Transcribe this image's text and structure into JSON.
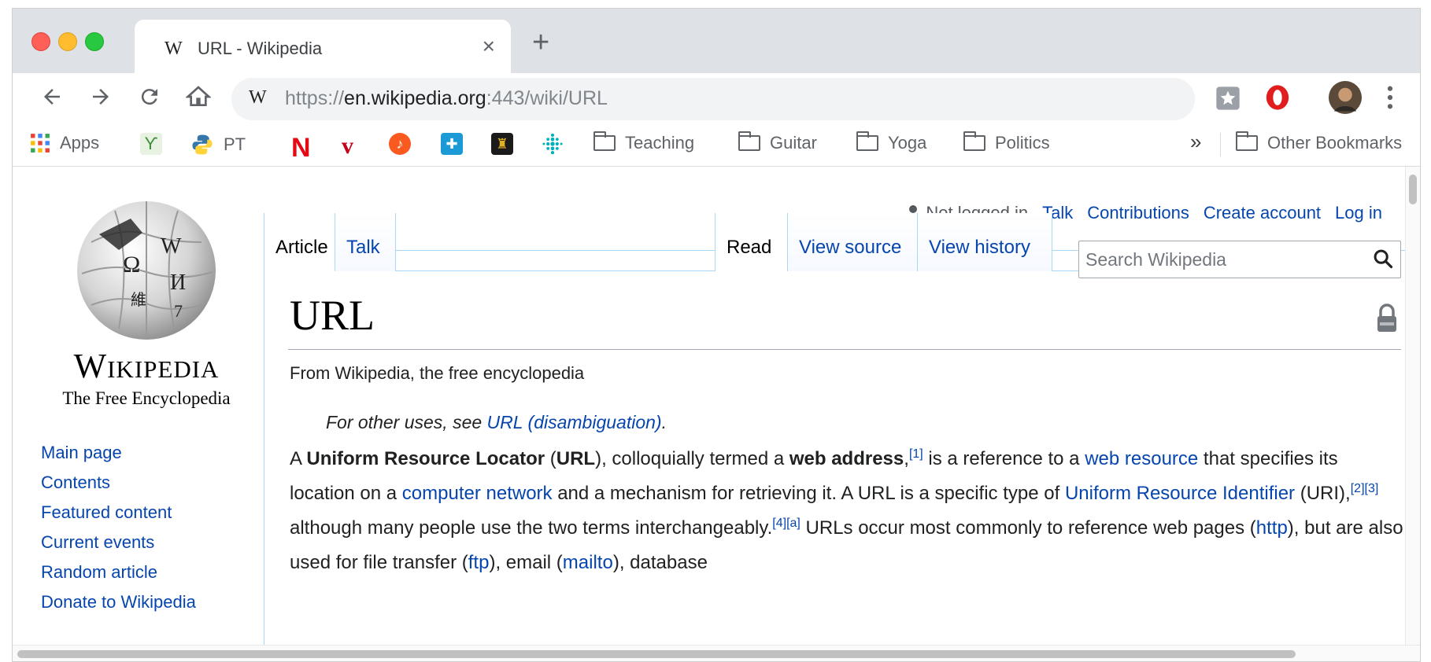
{
  "browser": {
    "tab_title": "URL - Wikipedia",
    "tab_favicon": "W",
    "tab_close": "×",
    "new_tab": "+",
    "url_scheme": "https://",
    "url_host": "en.wikipedia.org",
    "url_rest": ":443/wiki/URL"
  },
  "bookmarks": {
    "apps": "Apps",
    "pt": "PT",
    "teaching": "Teaching",
    "guitar": "Guitar",
    "yoga": "Yoga",
    "politics": "Politics",
    "overflow": "»",
    "other": "Other Bookmarks"
  },
  "personal": {
    "status": "Not logged in",
    "talk": "Talk",
    "contributions": "Contributions",
    "create_account": "Create account",
    "log_in": "Log in"
  },
  "logo": {
    "wordmark": "Wikipedia",
    "tagline": "The Free Encyclopedia"
  },
  "sidebar": {
    "items": [
      "Main page",
      "Contents",
      "Featured content",
      "Current events",
      "Random article",
      "Donate to Wikipedia"
    ]
  },
  "tabs": {
    "article": "Article",
    "talk": "Talk",
    "read": "Read",
    "view_source": "View source",
    "view_history": "View history"
  },
  "search": {
    "placeholder": "Search Wikipedia"
  },
  "article": {
    "title": "URL",
    "sitesub": "From Wikipedia, the free encyclopedia",
    "hatnote_prefix": "For other uses, see ",
    "hatnote_link": "URL (disambiguation)",
    "hatnote_suffix": ".",
    "p": {
      "t1": "A ",
      "b1": "Uniform Resource Locator",
      "t2": " (",
      "b2": "URL",
      "t3": "), colloquially termed a ",
      "b3": "web address",
      "t4": ",",
      "ref1": "[1]",
      "t5": " is a reference to a ",
      "l1": "web resource",
      "t6": " that specifies its location on a ",
      "l2": "computer network",
      "t7": " and a mechanism for retrieving it. A URL is a specific type of ",
      "l3": "Uniform Resource Identifier",
      "t8": " (URI),",
      "ref2": "[2]",
      "ref3": "[3]",
      "t9": " although many people use the two terms interchangeably.",
      "ref4": "[4]",
      "refa": "[a]",
      "t10": " URLs occur most commonly to reference web pages (",
      "l4": "http",
      "t11": "), but are also used for file transfer (",
      "l5": "ftp",
      "t12": "), email (",
      "l6": "mailto",
      "t13": "), database"
    }
  }
}
